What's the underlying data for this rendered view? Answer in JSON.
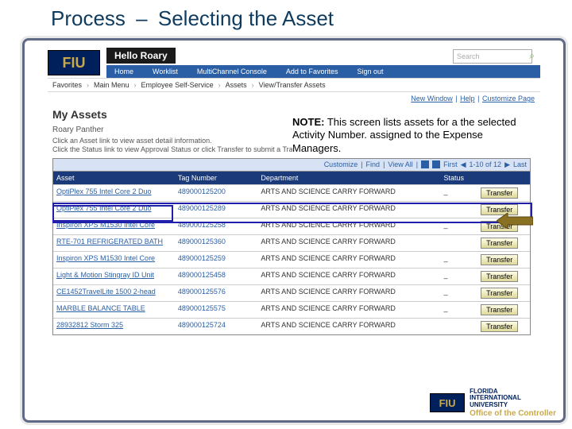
{
  "slide": {
    "title_prefix": "Process",
    "title_dash": "–",
    "title_suffix": "Selecting the Asset"
  },
  "note": {
    "label": "NOTE:",
    "text": " This screen lists assets for a the selected Activity Number. assigned to the Expense Managers."
  },
  "app": {
    "logo": "FIU",
    "hello": "Hello Roary",
    "search_placeholder": "Search",
    "nav": [
      "Home",
      "Worklist",
      "MultiChannel Console",
      "Add to Favorites",
      "Sign out"
    ],
    "breadcrumb": [
      "Favorites",
      "Main Menu",
      "Employee Self-Service",
      "Assets",
      "View/Transfer Assets"
    ],
    "right_links": [
      "New Window",
      "Help",
      "Customize Page"
    ],
    "page_title": "My Assets",
    "user": "Roary Panther",
    "instructions": [
      "Click an Asset link to view asset detail information.",
      "Click the Status link to view Approval Status or click Transfer to submit a Transfer Request."
    ],
    "toolbar": {
      "customize": "Customize",
      "find": "Find",
      "view_all": "View All",
      "pager_first": "First",
      "pager_range": "1-10 of 12",
      "pager_last": "Last"
    },
    "columns": [
      "Asset",
      "Tag Number",
      "Department",
      "Status",
      ""
    ],
    "action_label": "Transfer",
    "rows": [
      {
        "asset": "OptiPlex 755 Intel Core 2 Duo",
        "tag": "489000125200",
        "dept": "ARTS AND SCIENCE CARRY FORWARD",
        "status": "_"
      },
      {
        "asset": "OptiPlex 755 Intel Core 2 Duo",
        "tag": "489000125289",
        "dept": "ARTS AND SCIENCE CARRY FORWARD",
        "status": ""
      },
      {
        "asset": "Inspiron XPS M1530 Intel Core",
        "tag": "489000125258",
        "dept": "ARTS AND SCIENCE CARRY FORWARD",
        "status": "_"
      },
      {
        "asset": "RTE-701 REFRIGERATED BATH",
        "tag": "489000125360",
        "dept": "ARTS AND SCIENCE CARRY FORWARD",
        "status": ""
      },
      {
        "asset": "Inspiron XPS M1530 Intel Core",
        "tag": "489000125259",
        "dept": "ARTS AND SCIENCE CARRY FORWARD",
        "status": "_"
      },
      {
        "asset": "Light & Motion Stingray ID Unit",
        "tag": "489000125458",
        "dept": "ARTS AND SCIENCE CARRY FORWARD",
        "status": "_"
      },
      {
        "asset": "CE1452TravelLite 1500 2-head",
        "tag": "489000125576",
        "dept": "ARTS AND SCIENCE CARRY FORWARD",
        "status": "_"
      },
      {
        "asset": "MARBLE BALANCE TABLE",
        "tag": "489000125575",
        "dept": "ARTS AND SCIENCE CARRY FORWARD",
        "status": "_"
      },
      {
        "asset": "28932812 Storm 325",
        "tag": "489000125724",
        "dept": "ARTS AND SCIENCE CARRY FORWARD",
        "status": ""
      }
    ]
  },
  "footer": {
    "logo": "FIU",
    "univ": "FLORIDA\nINTERNATIONAL\nUNIVERSITY",
    "office": "Office of the Controller"
  }
}
